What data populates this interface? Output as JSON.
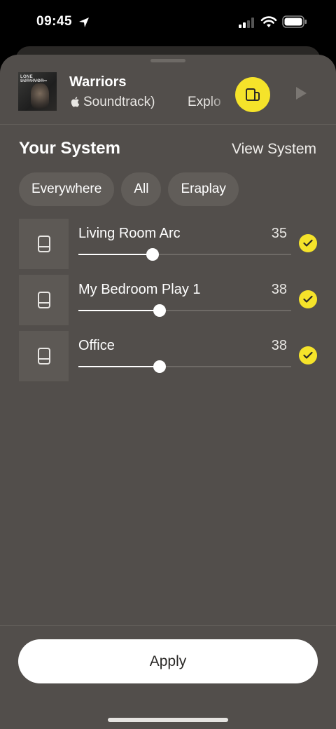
{
  "status_bar": {
    "time": "09:45",
    "location_icon": "location-arrow-icon",
    "signal_icon": "cellular-signal-icon",
    "wifi_icon": "wifi-icon",
    "battery_icon": "battery-icon"
  },
  "now_playing": {
    "title": "Warriors",
    "subtitle": "Soundtrack)",
    "subtitle_continued": "Explo",
    "album_art_text": "LONE SURVIVOR",
    "source_icon": "apple-icon",
    "group_icon": "speaker-group-icon",
    "play_icon": "play-icon"
  },
  "system": {
    "title": "Your System",
    "view_link": "View System"
  },
  "filters": [
    "Everywhere",
    "All",
    "Eraplay"
  ],
  "rooms": [
    {
      "name": "Living Room Arc",
      "volume": "35",
      "level": 0.35,
      "selected": true
    },
    {
      "name": "My Bedroom Play 1",
      "volume": "38",
      "level": 0.38,
      "selected": true
    },
    {
      "name": "Office",
      "volume": "38",
      "level": 0.38,
      "selected": true
    }
  ],
  "footer": {
    "apply_label": "Apply"
  },
  "colors": {
    "sheet": "#524e4b",
    "accent": "#f5e32a",
    "chip": "#615d59"
  }
}
